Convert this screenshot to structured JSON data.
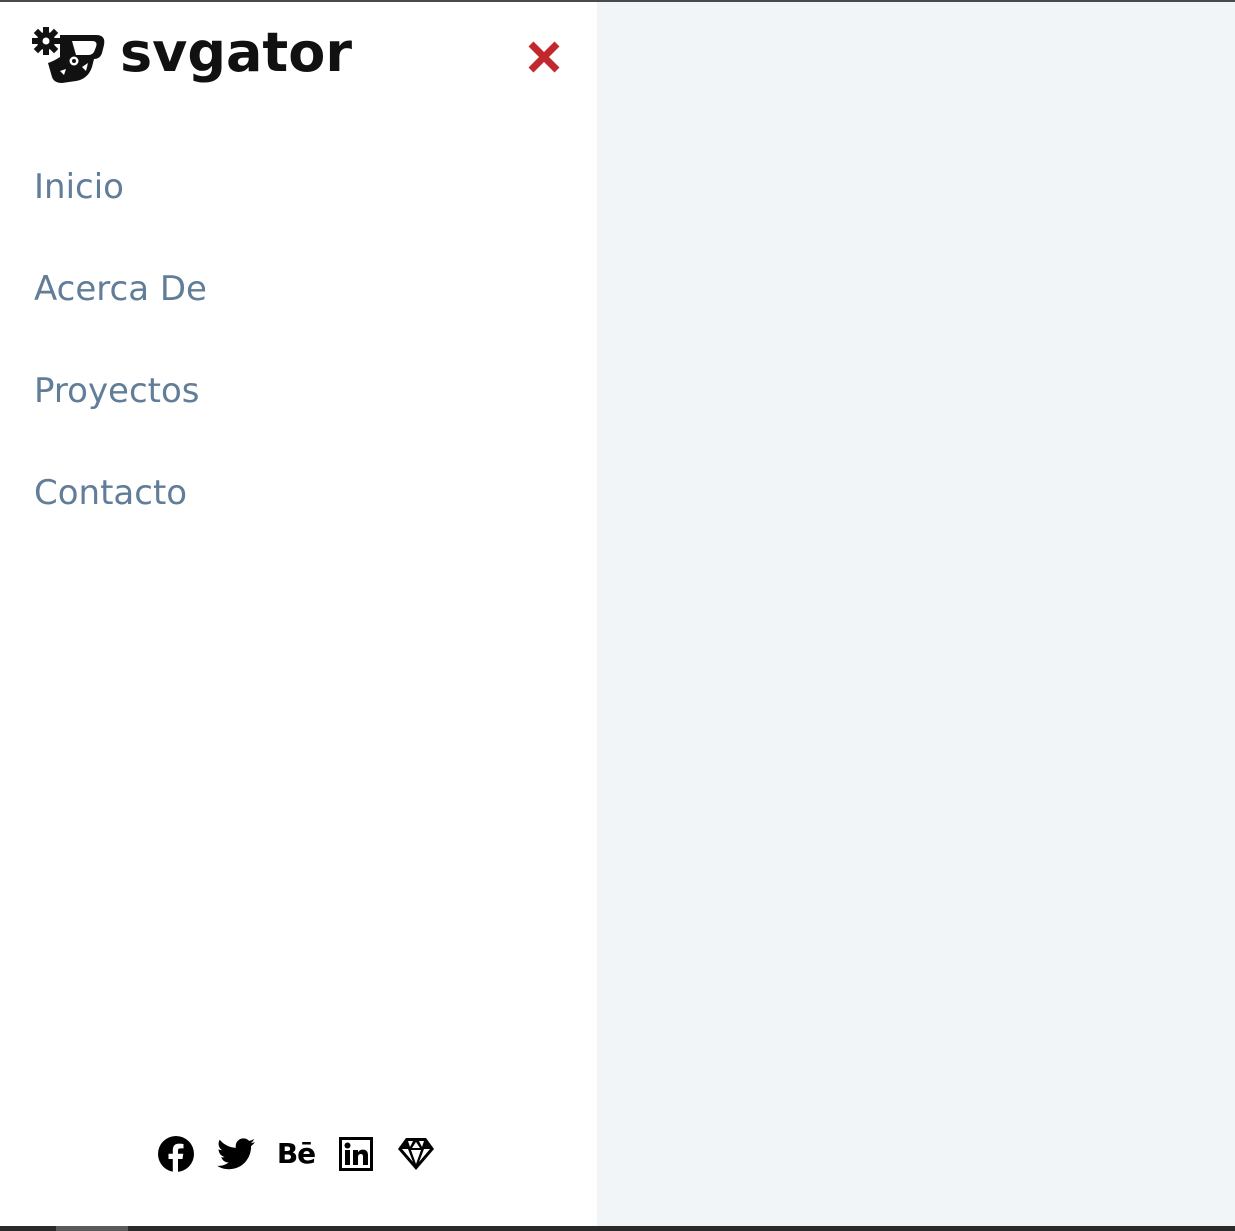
{
  "brand": {
    "name": "svgator",
    "logo_icon": "gator-gear-icon"
  },
  "close_icon": "close-icon",
  "nav": {
    "items": [
      {
        "label": "Inicio"
      },
      {
        "label": "Acerca De"
      },
      {
        "label": "Proyectos"
      },
      {
        "label": "Contacto"
      }
    ]
  },
  "social": {
    "items": [
      {
        "icon": "facebook-icon"
      },
      {
        "icon": "twitter-icon"
      },
      {
        "icon": "behance-icon",
        "glyph": "Bē"
      },
      {
        "icon": "linkedin-icon"
      },
      {
        "icon": "sketch-icon"
      }
    ]
  },
  "colors": {
    "nav_text": "#617d98",
    "close": "#c1272d",
    "backdrop": "#f1f5f8",
    "drawer": "#ffffff"
  }
}
